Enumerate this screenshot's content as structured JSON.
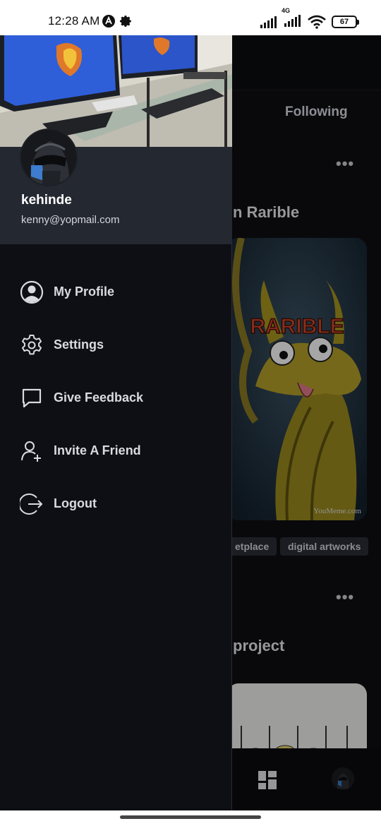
{
  "status_bar": {
    "time": "12:28 AM",
    "network": "4G",
    "battery": "67"
  },
  "feed": {
    "tab_following": "Following",
    "post1_title": "n Rarible",
    "post1_image_text": "RARIBLE",
    "post1_watermark": "YouMeme.com",
    "tags": [
      "etplace",
      "digital artworks"
    ],
    "post2_title": "project"
  },
  "drawer": {
    "user_name": "kehinde",
    "user_email": "kenny@yopmail.com",
    "menu": [
      {
        "label": "My Profile",
        "icon": "user-circle-icon"
      },
      {
        "label": "Settings",
        "icon": "gear-icon"
      },
      {
        "label": "Give Feedback",
        "icon": "chat-bubble-icon"
      },
      {
        "label": "Invite A Friend",
        "icon": "add-user-icon"
      },
      {
        "label": "Logout",
        "icon": "logout-icon"
      }
    ]
  },
  "colors": {
    "drawer_bg": "#0e0f14",
    "profile_bg": "#242831",
    "menu_text": "#d8dbe2"
  }
}
